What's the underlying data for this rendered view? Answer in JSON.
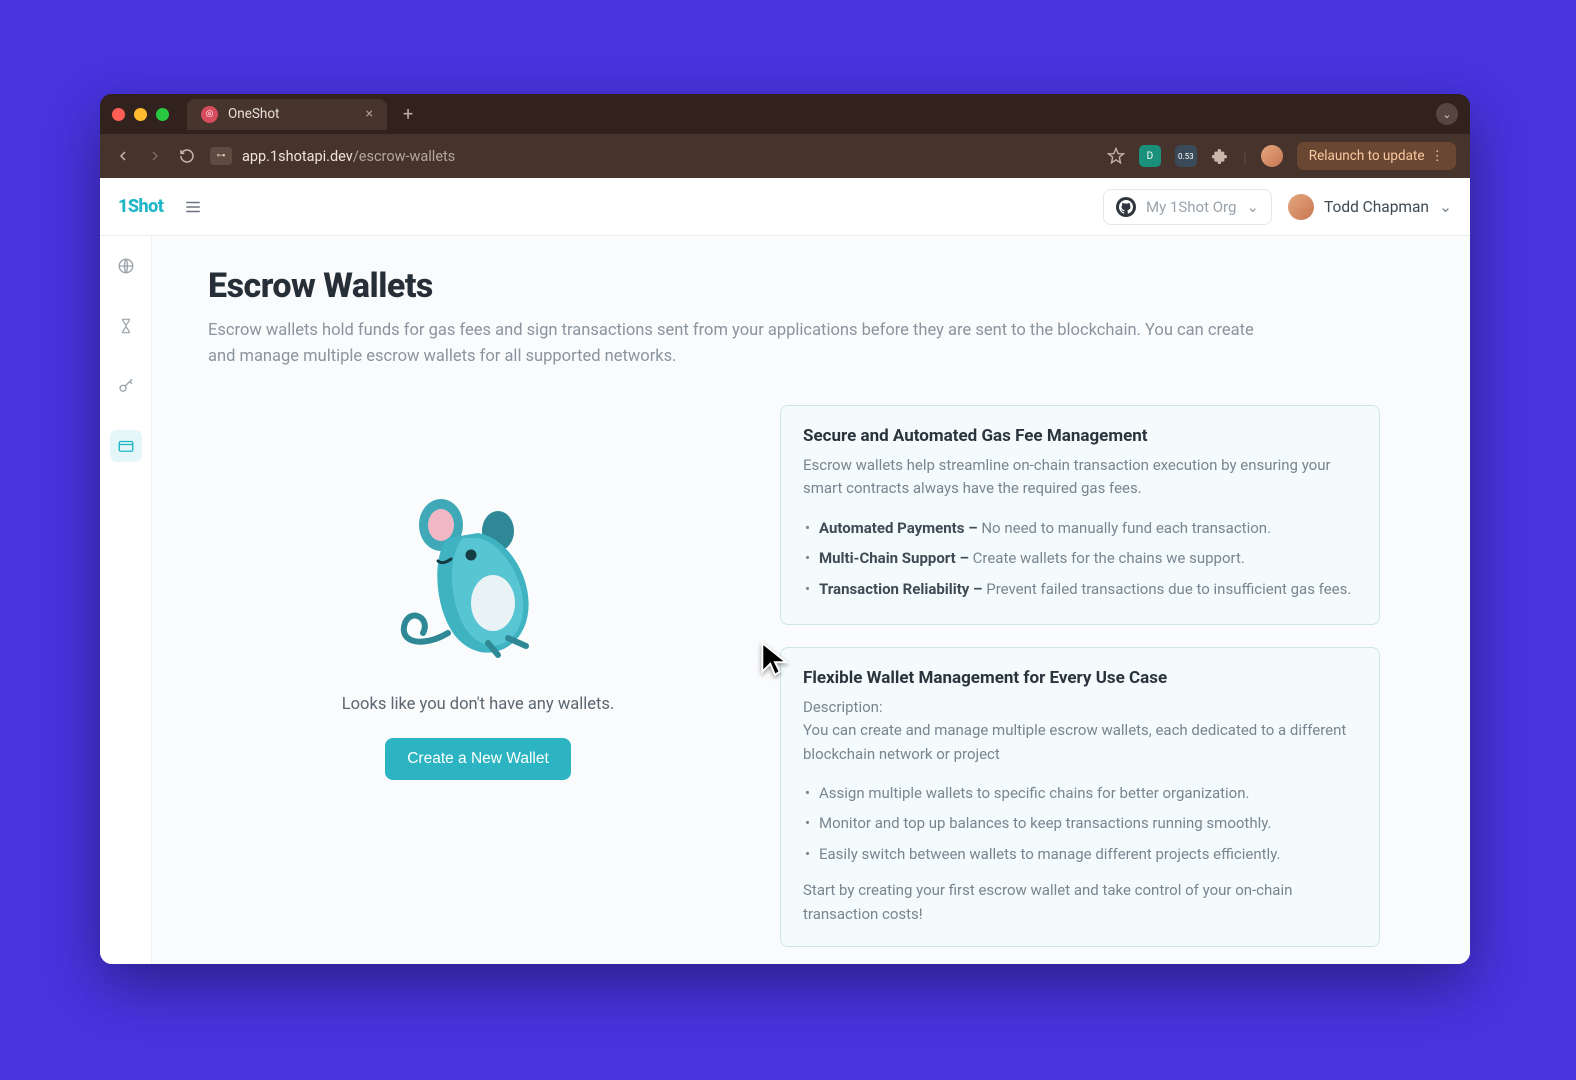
{
  "browser": {
    "tab_title": "OneShot",
    "url_domain": "app.1shotapi.dev",
    "url_path": "/escrow-wallets",
    "relaunch_label": "Relaunch to update",
    "ext_badge": "0.53"
  },
  "header": {
    "logo": "1Shot",
    "org_label": "My 1Shot Org",
    "user_name": "Todd Chapman"
  },
  "page": {
    "title": "Escrow Wallets",
    "description": "Escrow wallets hold funds for gas fees and sign transactions sent from your applications before they are sent to the blockchain. You can create and manage multiple escrow wallets for all supported networks."
  },
  "empty": {
    "message": "Looks like you don't have any wallets.",
    "cta": "Create a New Wallet"
  },
  "cards": [
    {
      "title": "Secure and Automated Gas Fee Management",
      "subtitle": "Escrow wallets help streamline on-chain transaction execution by ensuring your smart contracts always have the required gas fees.",
      "bullets": [
        {
          "bold": "Automated Payments –",
          "text": " No need to manually fund each transaction."
        },
        {
          "bold": "Multi-Chain Support –",
          "text": " Create wallets for the chains we support."
        },
        {
          "bold": "Transaction Reliability –",
          "text": " Prevent failed transactions due to insufficient gas fees."
        }
      ]
    },
    {
      "title": "Flexible Wallet Management for Every Use Case",
      "subtitle_label": "Description:",
      "subtitle": "You can create and manage multiple escrow wallets, each dedicated to a different blockchain network or project",
      "bullets": [
        {
          "text": "Assign multiple wallets to specific chains for better organization."
        },
        {
          "text": "Monitor and top up balances to keep transactions running smoothly."
        },
        {
          "text": "Easily switch between wallets to manage different projects efficiently."
        }
      ],
      "footer": "Start by creating your first escrow wallet and take control of your on-chain transaction costs!"
    }
  ]
}
